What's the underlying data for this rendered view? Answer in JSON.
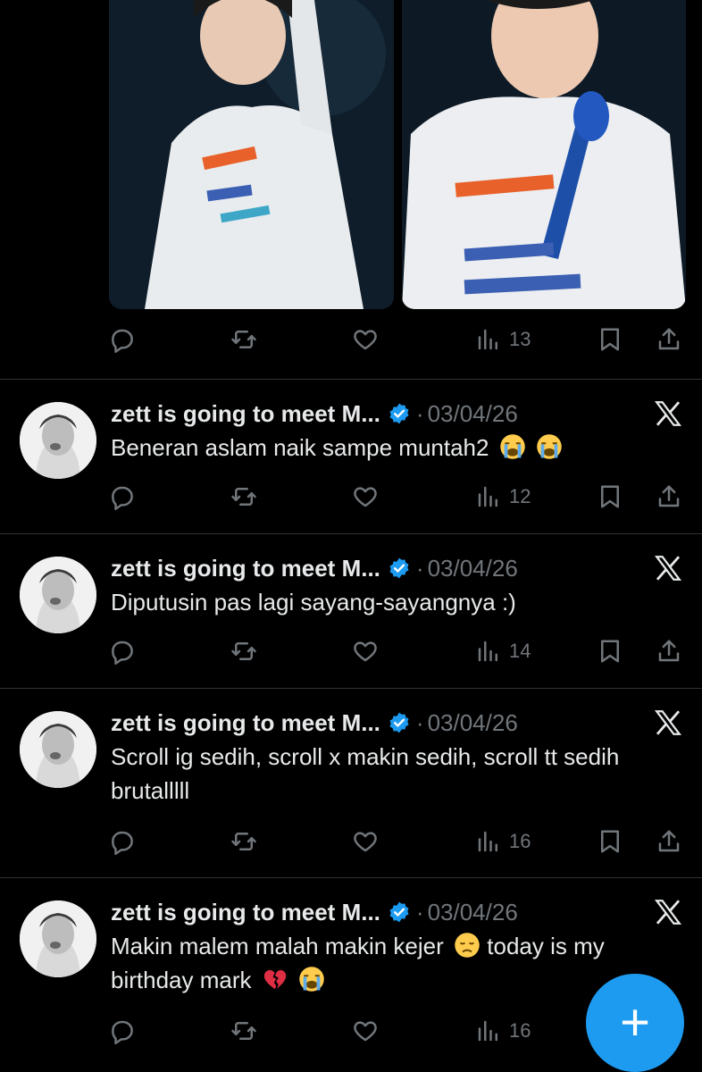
{
  "colors": {
    "background": "#000000",
    "text": "#e7e9ea",
    "muted": "#71767b",
    "accent": "#1d9bf0",
    "divider": "#2f3336"
  },
  "top_post": {
    "stats": {
      "views": "13"
    }
  },
  "tweets": [
    {
      "author": "zett is going to meet M...",
      "date": "03/04/26",
      "dot": "·",
      "text": "Beneran aslam naik sampe muntah2",
      "emojis": [
        "loudly-crying-face",
        "loudly-crying-face"
      ],
      "views": "12"
    },
    {
      "author": "zett is going to meet M...",
      "date": "03/04/26",
      "dot": "·",
      "text": "Diputusin pas lagi sayang-sayangnya :)",
      "emojis": [],
      "views": "14"
    },
    {
      "author": "zett is going to meet M...",
      "date": "03/04/26",
      "dot": "·",
      "text": "Scroll ig sedih, scroll x makin sedih, scroll tt sedih brutalllll",
      "emojis": [],
      "views": "16"
    },
    {
      "author": "zett is going to meet M...",
      "date": "03/04/26",
      "dot": "·",
      "text_part1": "Makin malem malah makin kejer",
      "text_part2": "today is my birthday mark",
      "emojis": [
        "disappointed-face",
        "broken-heart",
        "loudly-crying-face"
      ],
      "views": "16"
    }
  ],
  "fab": {
    "label": "+",
    "icon": "compose-plus-icon"
  }
}
